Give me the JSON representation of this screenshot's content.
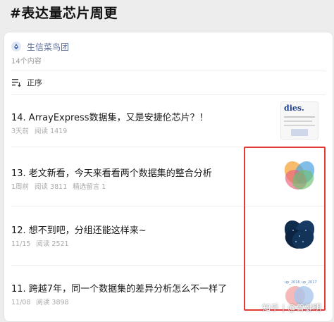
{
  "page_title": "#表达量芯片周更",
  "account": {
    "name": "生信菜鸟团",
    "count_label": "14个内容"
  },
  "sort": {
    "label": "正序",
    "icon": "sort-list-icon"
  },
  "articles": [
    {
      "title": "14. ArrayExpress数据集，又是安捷伦芯片？！",
      "date": "3天前",
      "reads": "阅读 1419",
      "extra": "",
      "thumb_icon": "paper-page-thumbnail",
      "thumb_text": "dies."
    },
    {
      "title": "13. 老文新看，今天来看看两个数据集的整合分析",
      "date": "1周前",
      "reads": "阅读 3811",
      "extra": "精选留言 1",
      "thumb_icon": "venn-diagram-thumbnail"
    },
    {
      "title": "12. 想不到吧，分组还能这样来~",
      "date": "11/15",
      "reads": "阅读 2521",
      "extra": "",
      "thumb_icon": "dark-venn-thumbnail"
    },
    {
      "title": "11. 跨越7年，同一个数据集的差异分析怎么不一样了",
      "date": "11/08",
      "reads": "阅读 3898",
      "extra": "",
      "thumb_icon": "two-circle-venn-thumbnail",
      "thumb_labels": [
        "up_2016",
        "up_2017"
      ]
    }
  ],
  "watermark": {
    "brand": "知乎",
    "author": "@曾健明"
  },
  "colors": {
    "link": "#576b95",
    "highlight_box": "#e53935",
    "meta": "#aaaaaa"
  }
}
